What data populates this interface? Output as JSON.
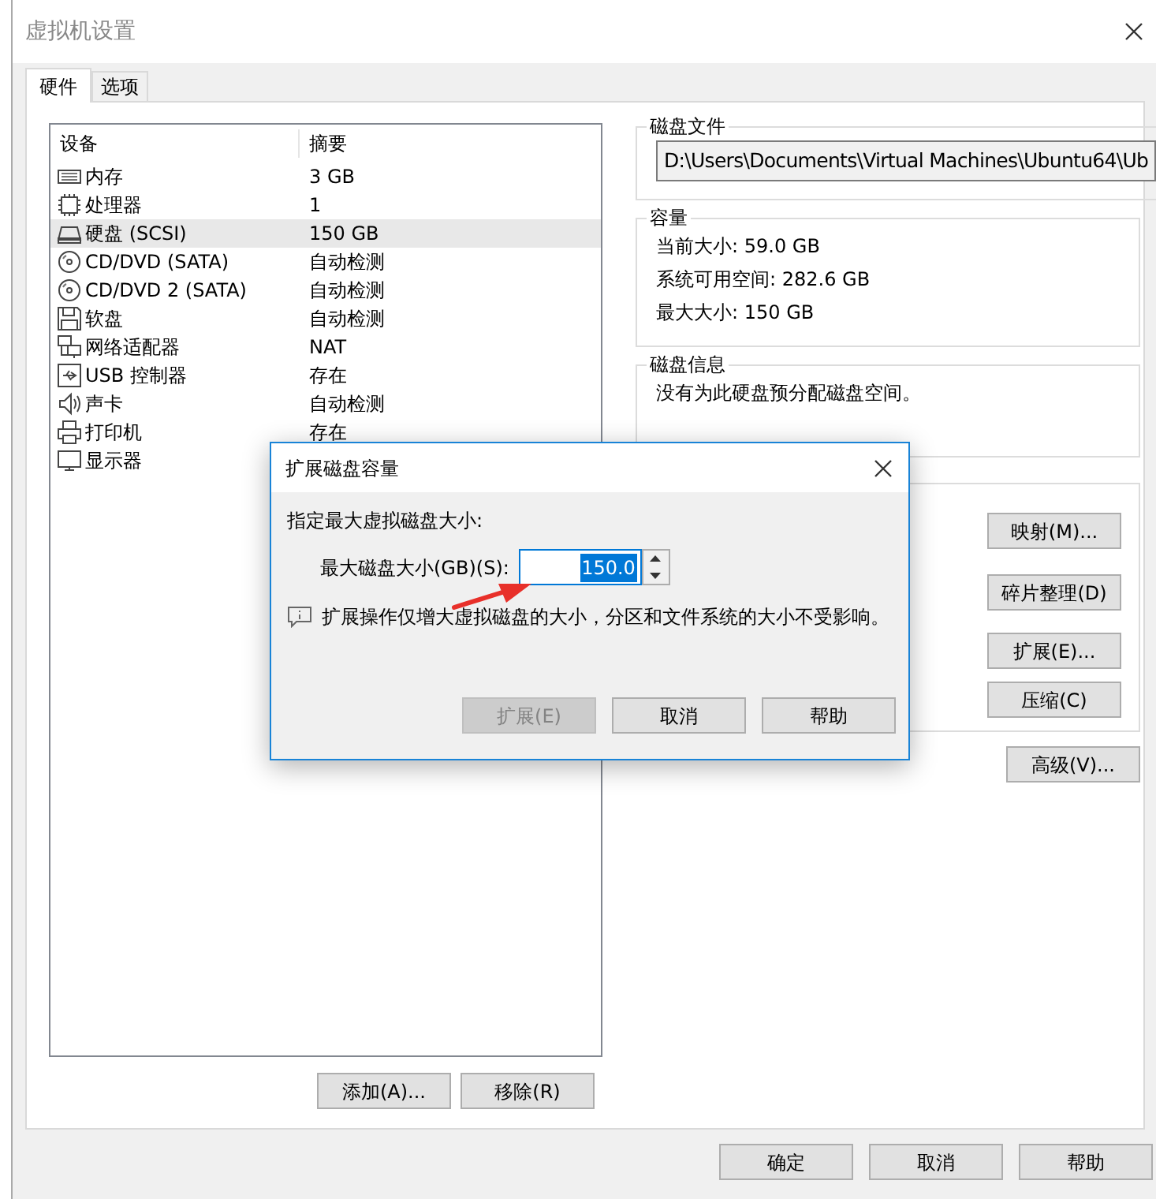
{
  "window": {
    "title": "虚拟机设置"
  },
  "tabs": [
    {
      "label": "硬件",
      "selected": true
    },
    {
      "label": "选项",
      "selected": false
    }
  ],
  "device_table": {
    "columns": [
      "设备",
      "摘要"
    ],
    "rows": [
      {
        "kind": "memory",
        "device": "内存",
        "summary": "3 GB",
        "selected": false
      },
      {
        "kind": "cpu",
        "device": "处理器",
        "summary": "1",
        "selected": false
      },
      {
        "kind": "disk",
        "device": "硬盘 (SCSI)",
        "summary": "150 GB",
        "selected": true
      },
      {
        "kind": "cdrom",
        "device": "CD/DVD (SATA)",
        "summary": "自动检测",
        "selected": false
      },
      {
        "kind": "cdrom",
        "device": "CD/DVD 2 (SATA)",
        "summary": "自动检测",
        "selected": false
      },
      {
        "kind": "floppy",
        "device": "软盘",
        "summary": "自动检测",
        "selected": false
      },
      {
        "kind": "network",
        "device": "网络适配器",
        "summary": "NAT",
        "selected": false
      },
      {
        "kind": "usb",
        "device": "USB 控制器",
        "summary": "存在",
        "selected": false
      },
      {
        "kind": "sound",
        "device": "声卡",
        "summary": "自动检测",
        "selected": false
      },
      {
        "kind": "printer",
        "device": "打印机",
        "summary": "存在",
        "selected": false
      },
      {
        "kind": "display",
        "device": "显示器",
        "selected": false
      }
    ]
  },
  "device_buttons": [
    "添加(A)...",
    "移除(R)"
  ],
  "disk_file": {
    "title": "磁盘文件",
    "path": "D:\\Users\\Documents\\Virtual Machines\\Ubuntu64\\Ub"
  },
  "capacity": {
    "title": "容量",
    "lines": [
      "当前大小: 59.0 GB",
      "系统可用空间: 282.6 GB",
      "最大大小: 150 GB"
    ]
  },
  "disk_info": {
    "title": "磁盘信息",
    "text": "没有为此硬盘预分配磁盘空间。"
  },
  "utility_buttons": [
    "映射(M)...",
    "碎片整理(D)",
    "扩展(E)...",
    "压缩(C)"
  ],
  "advanced_button": "高级(V)...",
  "footer_buttons": [
    "确定",
    "取消",
    "帮助"
  ],
  "dialog": {
    "title": "扩展磁盘容量",
    "prompt": "指定最大虚拟磁盘大小:",
    "field_label": "最大磁盘大小(GB)(S):",
    "value": "150.0",
    "note": "扩展操作仅增大虚拟磁盘的大小，分区和文件系统的大小不受影响。",
    "buttons": [
      {
        "label": "扩展(E)",
        "disabled": true
      },
      {
        "label": "取消",
        "disabled": false
      },
      {
        "label": "帮助",
        "disabled": false
      }
    ]
  }
}
